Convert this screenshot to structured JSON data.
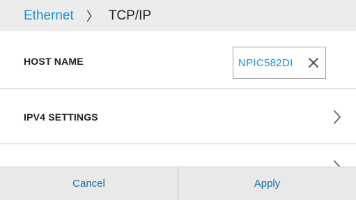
{
  "breadcrumb": {
    "parent": "Ethernet",
    "separator": "〉",
    "current": "TCP/IP"
  },
  "rows": {
    "host_name": {
      "label": "HOST NAME",
      "value": "NPIC582DI",
      "clear_icon": "close-icon"
    },
    "ipv4": {
      "label": "IPV4 SETTINGS",
      "chevron_icon": "chevron-right-icon"
    }
  },
  "footer": {
    "cancel_label": "Cancel",
    "apply_label": "Apply"
  },
  "colors": {
    "accent": "#1e8fd2",
    "header_bg": "#ececec",
    "footer_bg": "#e9e9e9"
  }
}
